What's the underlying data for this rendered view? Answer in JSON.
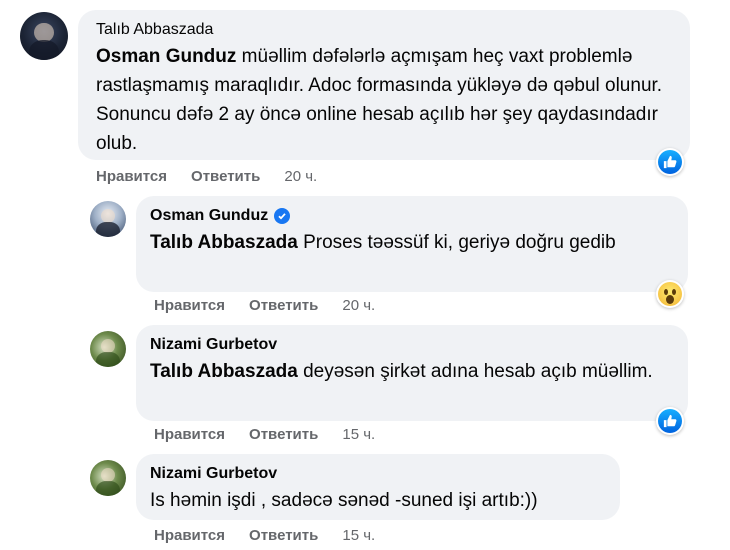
{
  "comments": [
    {
      "author": "Talıb Abbaszada",
      "mention": "Osman Gunduz",
      "text": " müəllim dəfələrlə açmışam heç vaxt problemlə rastlaşmamış maraqlıdır. Adoc formasında yükləyə də qəbul olunur. Sonuncu dəfə 2 ay öncə online hesab açılıb hər şey qaydasındadır olub.",
      "like": "Нравится",
      "reply": "Ответить",
      "time": "20 ч.",
      "reaction": "like-icon"
    },
    {
      "author": "Osman Gunduz",
      "verified": true,
      "mention": "Talıb Abbaszada",
      "text": " Proses təəssüf ki, geriyə doğru gedib",
      "like": "Нравится",
      "reply": "Ответить",
      "time": "20 ч.",
      "reaction": "wow-icon"
    },
    {
      "author": "Nizami Gurbetov",
      "mention": "Talıb Abbaszada",
      "text": " deyəsən şirkət adına hesab açıb müəllim.",
      "like": "Нравится",
      "reply": "Ответить",
      "time": "15 ч.",
      "reaction": "like-icon"
    },
    {
      "author": "Nizami Gurbetov",
      "mention": "",
      "text": "Is həmin işdi , sadəcə sənəd -suned işi artıb:))",
      "like": "Нравится",
      "reply": "Ответить",
      "time": "15 ч.",
      "reaction": ""
    }
  ],
  "colors": {
    "bubble": "#f0f2f5",
    "meta_text": "#65676b",
    "verified_blue": "#1877f2",
    "like_blue": "#0062df"
  }
}
